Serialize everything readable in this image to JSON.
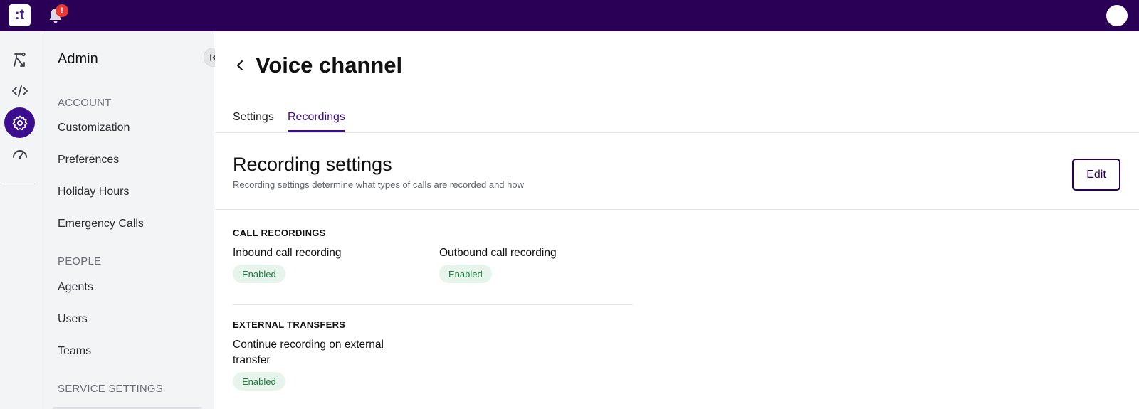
{
  "topbar": {
    "logo_text": ":t",
    "notification_badge": "!",
    "icons": [
      "bell-icon",
      "avatar"
    ]
  },
  "rail": {
    "icons": [
      "routing-icon",
      "code-icon",
      "gear-icon",
      "gauge-icon"
    ],
    "active": "gear-icon"
  },
  "sidebar": {
    "title": "Admin",
    "sections": [
      {
        "label": "ACCOUNT",
        "items": [
          "Customization",
          "Preferences",
          "Holiday Hours",
          "Emergency Calls"
        ]
      },
      {
        "label": "PEOPLE",
        "items": [
          "Agents",
          "Users",
          "Teams"
        ]
      },
      {
        "label": "SERVICE SETTINGS",
        "items": []
      }
    ]
  },
  "page": {
    "title": "Voice channel",
    "tabs": [
      {
        "label": "Settings",
        "active": false
      },
      {
        "label": "Recordings",
        "active": true
      }
    ]
  },
  "recording": {
    "title": "Recording settings",
    "subtitle": "Recording settings determine what types of calls are recorded and how",
    "edit_label": "Edit",
    "groups": [
      {
        "label": "CALL RECORDINGS",
        "fields": [
          {
            "label": "Inbound call recording",
            "status": "Enabled"
          },
          {
            "label": "Outbound call recording",
            "status": "Enabled"
          }
        ]
      },
      {
        "label": "EXTERNAL TRANSFERS",
        "fields": [
          {
            "label": "Continue recording on external transfer",
            "status": "Enabled"
          }
        ]
      }
    ]
  },
  "colors": {
    "topbar": "#2a0057",
    "accent": "#3d0d8f",
    "badge_bg": "#e6f4ec",
    "badge_text": "#1e7a3e"
  }
}
